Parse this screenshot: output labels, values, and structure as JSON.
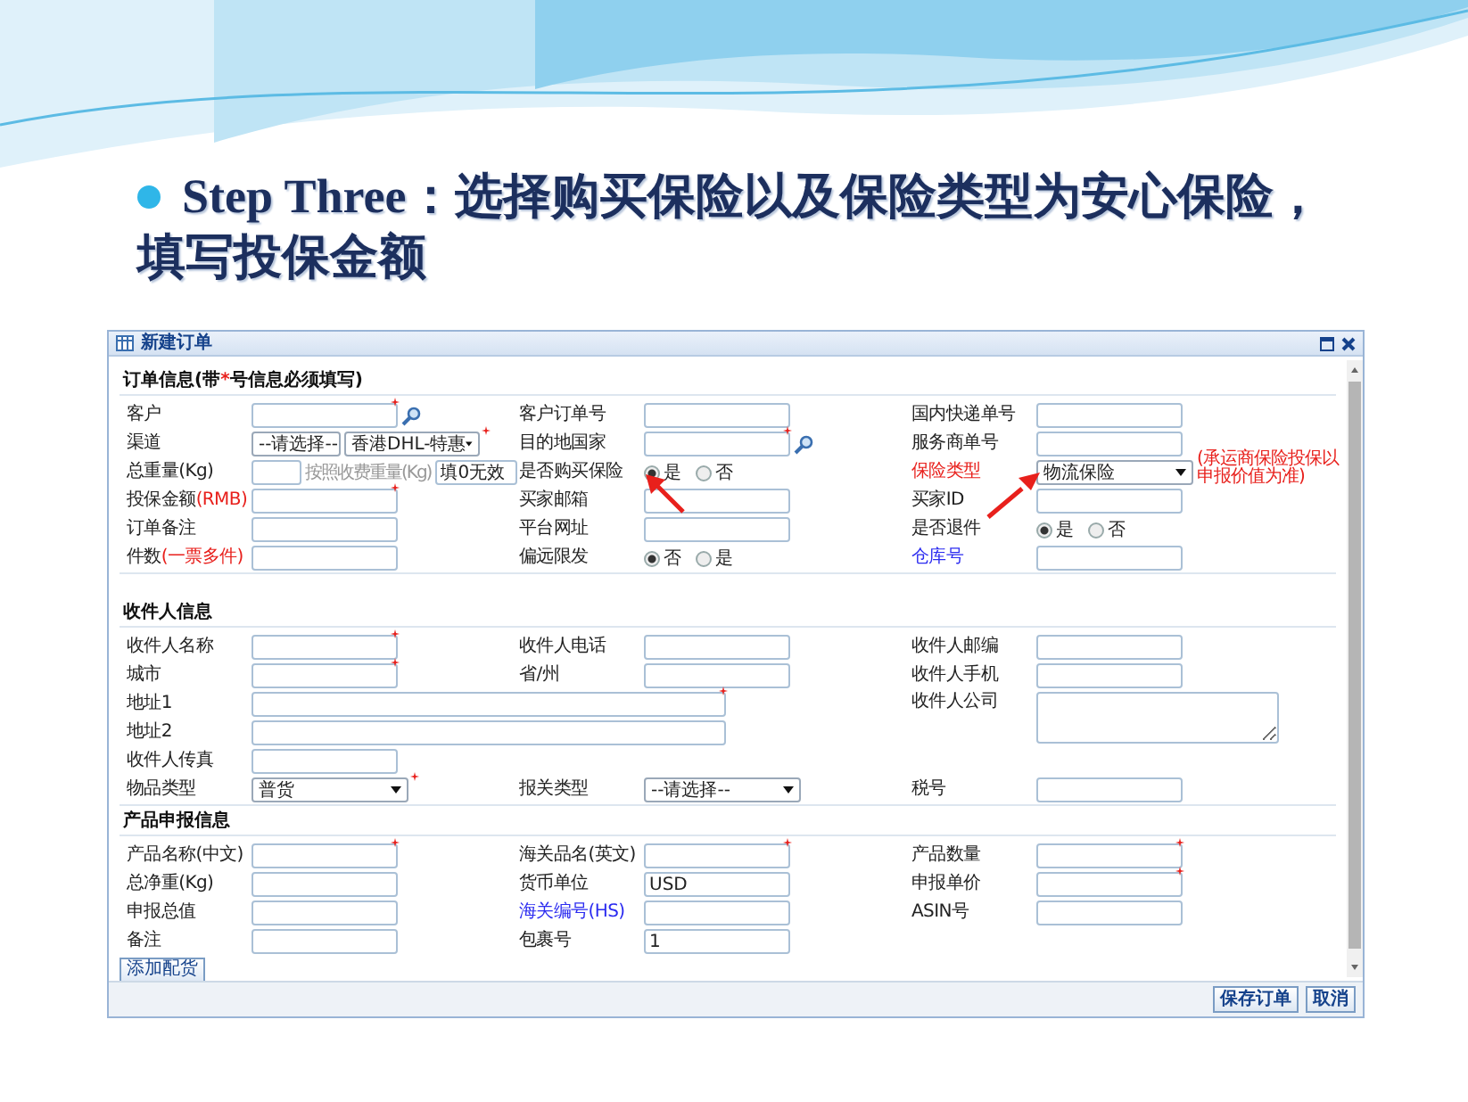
{
  "slide": {
    "heading_lines": [
      "Step Three：选择购买保险以及保险类型为安心保险，",
      "填写投保金额"
    ]
  },
  "window": {
    "title": "新建订单",
    "sections": [
      {
        "title_parts": [
          {
            "text": "订单信息(带"
          },
          {
            "text": "*",
            "color": "#e8201c"
          },
          {
            "text": "号信息必须填写)"
          }
        ],
        "rows": [
          {
            "cells": [
              {
                "label": "客户",
                "controls": [
                  {
                    "kind": "text",
                    "required": true
                  },
                  {
                    "kind": "search"
                  }
                ]
              },
              {
                "label": "客户订单号",
                "controls": [
                  {
                    "kind": "text"
                  }
                ]
              },
              {
                "label": "国内快递单号",
                "controls": [
                  {
                    "kind": "text"
                  }
                ]
              }
            ]
          },
          {
            "cells": [
              {
                "label": "渠道",
                "controls": [
                  {
                    "kind": "short_select",
                    "value": "--请选择--"
                  },
                  {
                    "kind": "medium_select",
                    "value": "香港DHL-特惠",
                    "required": true
                  }
                ]
              },
              {
                "label": "目的地国家",
                "controls": [
                  {
                    "kind": "text",
                    "required": true
                  },
                  {
                    "kind": "search"
                  }
                ]
              },
              {
                "label": "服务商单号",
                "controls": [
                  {
                    "kind": "text"
                  }
                ]
              }
            ]
          },
          {
            "cells": [
              {
                "label": "总重量(Kg)",
                "controls": [
                  {
                    "kind": "short_text"
                  },
                  {
                    "kind": "hint",
                    "text": "按照收费重量(Kg)"
                  },
                  {
                    "kind": "short_text",
                    "value": "填0无效"
                  }
                ]
              },
              {
                "label": "是否购买保险",
                "controls": [
                  {
                    "kind": "radio",
                    "options": [
                      {
                        "label": "是",
                        "selected": true
                      },
                      {
                        "label": "否",
                        "selected": false
                      }
                    ]
                  }
                ]
              },
              {
                "label": "保险类型",
                "color": "#e8201c",
                "controls": [
                  {
                    "kind": "select",
                    "value": "物流保险"
                  },
                  {
                    "kind": "note",
                    "text": "(承运商保险投保以申报价值为准)"
                  }
                ]
              }
            ]
          },
          {
            "cells": [
              {
                "label": "投保金额",
                "note": "(RMB)",
                "controls": [
                  {
                    "kind": "text",
                    "required": true
                  }
                ]
              },
              {
                "label": "买家邮箱",
                "controls": [
                  {
                    "kind": "text"
                  }
                ]
              },
              {
                "label": "买家ID",
                "controls": [
                  {
                    "kind": "text"
                  }
                ]
              }
            ]
          },
          {
            "cells": [
              {
                "label": "订单备注",
                "controls": [
                  {
                    "kind": "text"
                  }
                ]
              },
              {
                "label": "平台网址",
                "controls": [
                  {
                    "kind": "text"
                  }
                ]
              },
              {
                "label": "是否退件",
                "controls": [
                  {
                    "kind": "radio",
                    "options": [
                      {
                        "label": "是",
                        "selected": true
                      },
                      {
                        "label": "否",
                        "selected": false
                      }
                    ]
                  }
                ]
              }
            ]
          },
          {
            "cells": [
              {
                "label": "件数",
                "note": "(一票多件)",
                "controls": [
                  {
                    "kind": "text"
                  }
                ]
              },
              {
                "label": "偏远限发",
                "controls": [
                  {
                    "kind": "radio",
                    "options": [
                      {
                        "label": "否",
                        "selected": true
                      },
                      {
                        "label": "是",
                        "selected": false
                      }
                    ]
                  }
                ]
              },
              {
                "label": "仓库号",
                "color": "#2b2bf0",
                "controls": [
                  {
                    "kind": "text"
                  }
                ]
              }
            ]
          }
        ]
      },
      {
        "title_parts": [
          {
            "text": "收件人信息"
          }
        ],
        "rows": [
          {
            "cells": [
              {
                "label": "收件人名称",
                "controls": [
                  {
                    "kind": "text",
                    "required": true
                  }
                ]
              },
              {
                "label": "收件人电话",
                "controls": [
                  {
                    "kind": "text"
                  }
                ]
              },
              {
                "label": "收件人邮编",
                "controls": [
                  {
                    "kind": "text"
                  }
                ]
              }
            ]
          },
          {
            "cells": [
              {
                "label": "城市",
                "controls": [
                  {
                    "kind": "text",
                    "required": true
                  }
                ]
              },
              {
                "label": "省/州",
                "controls": [
                  {
                    "kind": "text"
                  }
                ]
              },
              {
                "label": "收件人手机",
                "controls": [
                  {
                    "kind": "text"
                  }
                ]
              }
            ]
          },
          {
            "cells": [
              {
                "label": "地址1",
                "controls": [
                  {
                    "kind": "wide_text",
                    "required": true
                  }
                ]
              },
              "",
              {
                "label": "收件人公司",
                "controls": [
                  {
                    "kind": "textarea"
                  }
                ]
              }
            ]
          },
          {
            "cells": [
              {
                "label": "地址2",
                "controls": [
                  {
                    "kind": "wide_text"
                  }
                ]
              },
              ""
            ]
          },
          {
            "cells": [
              {
                "label": "收件人传真",
                "controls": [
                  {
                    "kind": "text"
                  }
                ]
              }
            ]
          },
          {
            "cells": [
              {
                "label": "物品类型",
                "controls": [
                  {
                    "kind": "select",
                    "value": "普货",
                    "required": true
                  }
                ]
              },
              {
                "label": "报关类型",
                "controls": [
                  {
                    "kind": "select",
                    "value": "--请选择--"
                  }
                ]
              },
              {
                "label": "税号",
                "controls": [
                  {
                    "kind": "text"
                  }
                ]
              }
            ]
          }
        ]
      },
      {
        "title_parts": [
          {
            "text": "产品申报信息"
          }
        ],
        "rows": [
          {
            "cells": [
              {
                "label": "产品名称(中文)",
                "controls": [
                  {
                    "kind": "text",
                    "required": true
                  }
                ]
              },
              {
                "label": "海关品名(英文)",
                "controls": [
                  {
                    "kind": "text",
                    "required": true
                  }
                ]
              },
              {
                "label": "产品数量",
                "controls": [
                  {
                    "kind": "text",
                    "required": true
                  }
                ]
              }
            ]
          },
          {
            "cells": [
              {
                "label": "总净重(Kg)",
                "controls": [
                  {
                    "kind": "text"
                  }
                ]
              },
              {
                "label": "货币单位",
                "controls": [
                  {
                    "kind": "text",
                    "value": "USD"
                  }
                ]
              },
              {
                "label": "申报单价",
                "controls": [
                  {
                    "kind": "text",
                    "required": true
                  }
                ]
              }
            ]
          },
          {
            "cells": [
              {
                "label": "申报总值",
                "controls": [
                  {
                    "kind": "text"
                  }
                ]
              },
              {
                "label": "海关编号(HS)",
                "color": "#2b2bf0",
                "controls": [
                  {
                    "kind": "text"
                  }
                ]
              },
              {
                "label": "ASIN号",
                "controls": [
                  {
                    "kind": "text"
                  }
                ]
              }
            ]
          },
          {
            "cells": [
              {
                "label": "备注",
                "controls": [
                  {
                    "kind": "text"
                  }
                ]
              },
              {
                "label": "包裹号",
                "controls": [
                  {
                    "kind": "text",
                    "value": "1"
                  }
                ]
              }
            ]
          }
        ]
      }
    ],
    "add_button": "添加配货",
    "footer_buttons": [
      "保存订单",
      "取消"
    ]
  }
}
